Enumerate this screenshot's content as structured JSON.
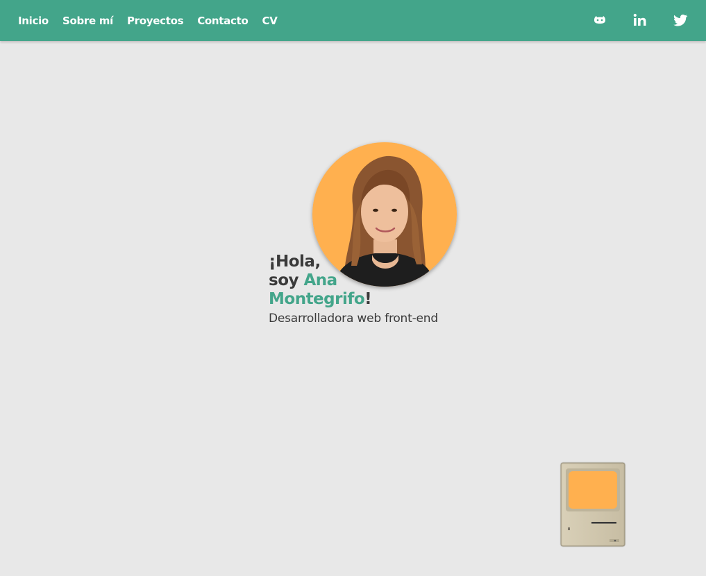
{
  "nav": {
    "links": [
      {
        "label": "Inicio"
      },
      {
        "label": "Sobre mí"
      },
      {
        "label": "Proyectos"
      },
      {
        "label": "Contacto"
      },
      {
        "label": "CV"
      }
    ],
    "social": [
      {
        "icon": "github-icon"
      },
      {
        "icon": "linkedin-icon"
      },
      {
        "icon": "twitter-icon"
      }
    ]
  },
  "hero": {
    "greeting_line1": "¡Hola,",
    "greeting_soy": "soy ",
    "name_first": "Ana",
    "name_last": "Montegrifo",
    "exclaim": "!",
    "subtitle": "Desarrolladora web front-end"
  },
  "colors": {
    "navbar": "#43a58a",
    "accent": "#43a58a",
    "background": "#e8e8e8",
    "text": "#3a3a3a",
    "avatar_bg": "#ffb04f",
    "screen": "#ffb04f"
  }
}
